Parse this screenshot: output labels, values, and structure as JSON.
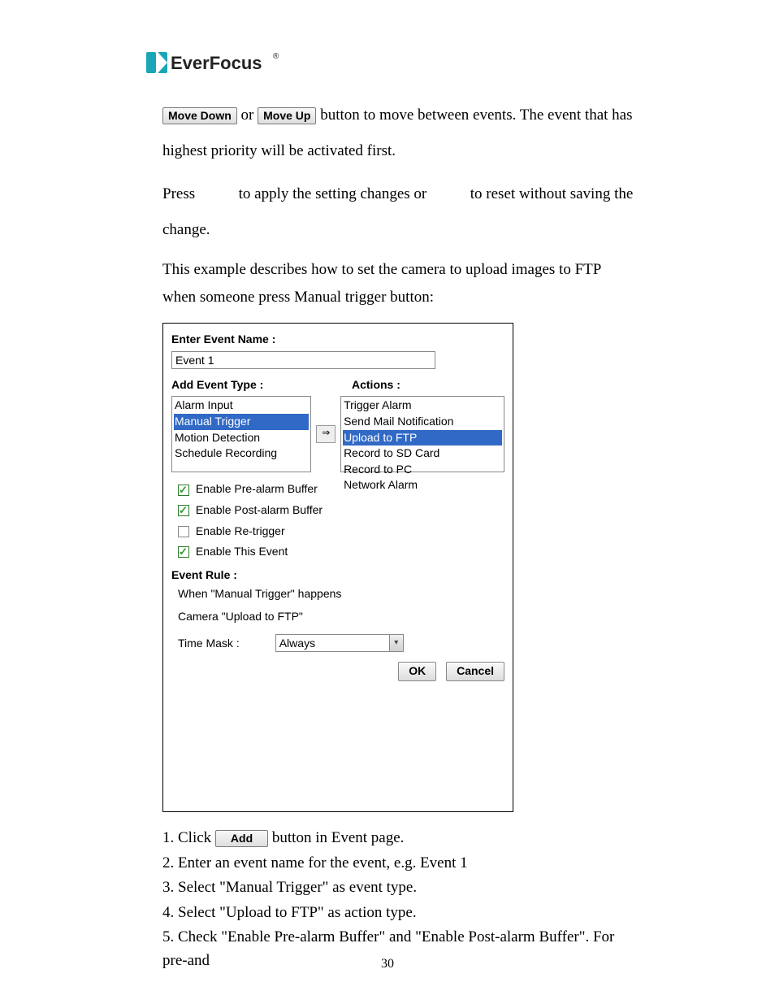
{
  "brand": "EverFocus",
  "buttons": {
    "move_down": "Move Down",
    "move_up": "Move Up",
    "add": "Add",
    "ok": "OK",
    "cancel": "Cancel"
  },
  "para1_a": "or",
  "para1_b": "button to move between events. The event that has highest priority will be activated first.",
  "para2_a": "Press",
  "para2_b": "to apply the setting changes or",
  "para2_c": "to reset without saving the change.",
  "para3": "This example describes how to set the camera to upload images to FTP when someone press Manual trigger button:",
  "dialog": {
    "enter_event_name": "Enter Event Name :",
    "event_name_value": "Event 1",
    "add_event_type": "Add Event Type :",
    "actions": "Actions :",
    "event_types": [
      "Alarm Input",
      "Manual Trigger",
      "Motion Detection",
      "Schedule Recording"
    ],
    "actions_list": [
      "Trigger Alarm",
      "Send Mail Notification",
      "Upload to FTP",
      "Record to SD Card",
      "Record to PC",
      "Network Alarm"
    ],
    "selected_event_type": "Manual Trigger",
    "selected_action": "Upload to FTP",
    "chk_pre": "Enable Pre-alarm Buffer",
    "chk_post": "Enable Post-alarm Buffer",
    "chk_retrigger": "Enable Re-trigger",
    "chk_enable": "Enable This Event",
    "event_rule": "Event Rule :",
    "rule_line1": "When \"Manual Trigger\" happens",
    "rule_line2": "Camera \"Upload to FTP\"",
    "time_mask": "Time Mask :",
    "time_mask_value": "Always"
  },
  "steps": {
    "s1_a": "1. Click",
    "s1_b": "button in Event page.",
    "s2": "2. Enter an event name for the event, e.g. Event 1",
    "s3": "3. Select \"Manual Trigger\" as event type.",
    "s4": "4. Select \"Upload to FTP\" as action type.",
    "s5": "5. Check \"Enable Pre-alarm Buffer\" and \"Enable Post-alarm Buffer\". For pre-and"
  },
  "page_number": "30"
}
